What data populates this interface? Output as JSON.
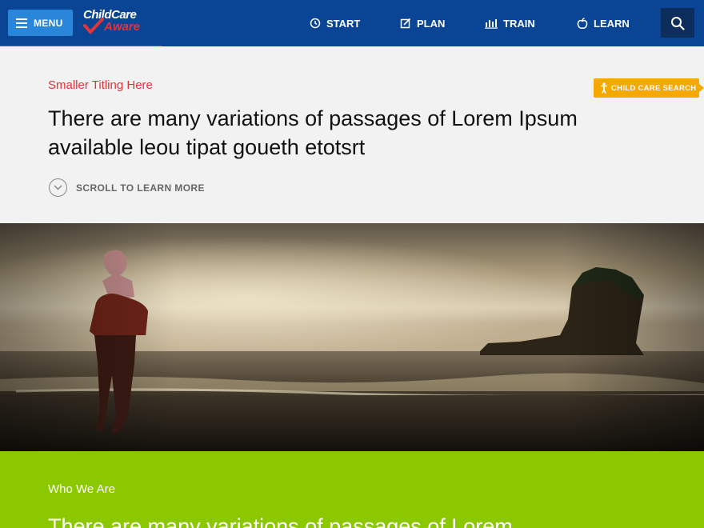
{
  "header": {
    "menu_label": "MENU",
    "logo_line1": "ChildCare",
    "logo_line2": "Aware",
    "nav": [
      {
        "label": "START",
        "icon": "clock-icon"
      },
      {
        "label": "PLAN",
        "icon": "edit-icon"
      },
      {
        "label": "TRAIN",
        "icon": "chart-icon"
      },
      {
        "label": "LEARN",
        "icon": "apple-icon"
      }
    ],
    "search_icon": "search-icon"
  },
  "hero": {
    "small_title": "Smaller Titling Here",
    "title": "There are many variations of passages of Lorem Ipsum available leou tipat goueth etotsrt",
    "scroll_label": "SCROLL TO LEARN MORE",
    "child_care_search_label": "CHILD CARE SEARCH"
  },
  "green_section": {
    "label": "Who We Are",
    "heading": "There are many variations of passages of Lorem"
  },
  "colors": {
    "header_bg": "#0a4494",
    "menu_bg": "#2a86d8",
    "accent_red": "#e0353a",
    "cc_search_bg": "#f5a800",
    "green": "#8cc800"
  }
}
